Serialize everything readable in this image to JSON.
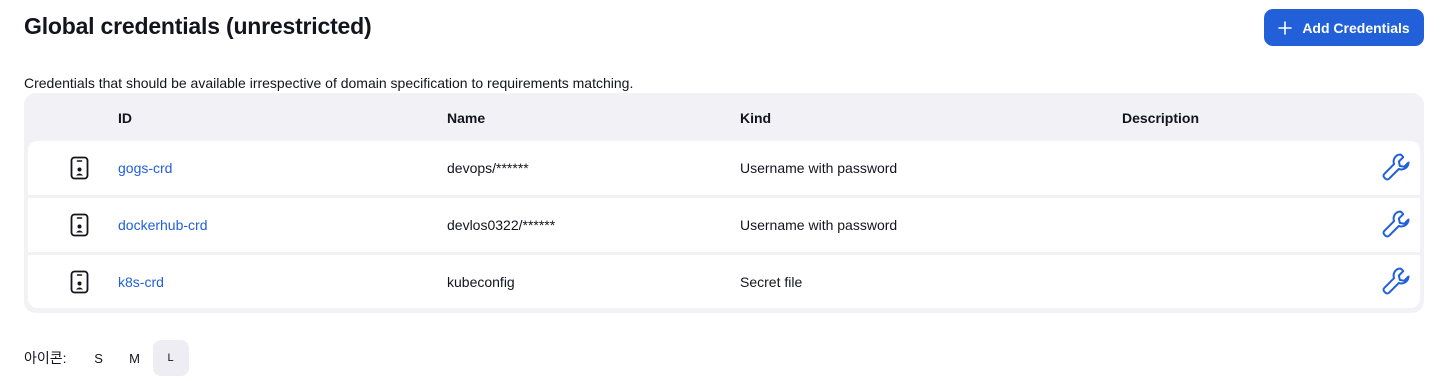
{
  "header": {
    "title": "Global credentials (unrestricted)",
    "add_button_label": "Add Credentials"
  },
  "description": "Credentials that should be available irrespective of domain specification to requirements matching.",
  "table": {
    "columns": [
      "ID",
      "Name",
      "Kind",
      "Description"
    ],
    "rows": [
      {
        "id": "gogs-crd",
        "name": "devops/******",
        "kind": "Username with password",
        "description": ""
      },
      {
        "id": "dockerhub-crd",
        "name": "devlos0322/******",
        "kind": "Username with password",
        "description": ""
      },
      {
        "id": "k8s-crd",
        "name": "kubeconfig",
        "kind": "Secret file",
        "description": ""
      }
    ]
  },
  "icon_size": {
    "label": "아이콘:",
    "options": [
      "S",
      "M",
      "L"
    ],
    "selected": "L"
  },
  "colors": {
    "accent": "#2160d8",
    "table_bg": "#f1f1f6"
  }
}
